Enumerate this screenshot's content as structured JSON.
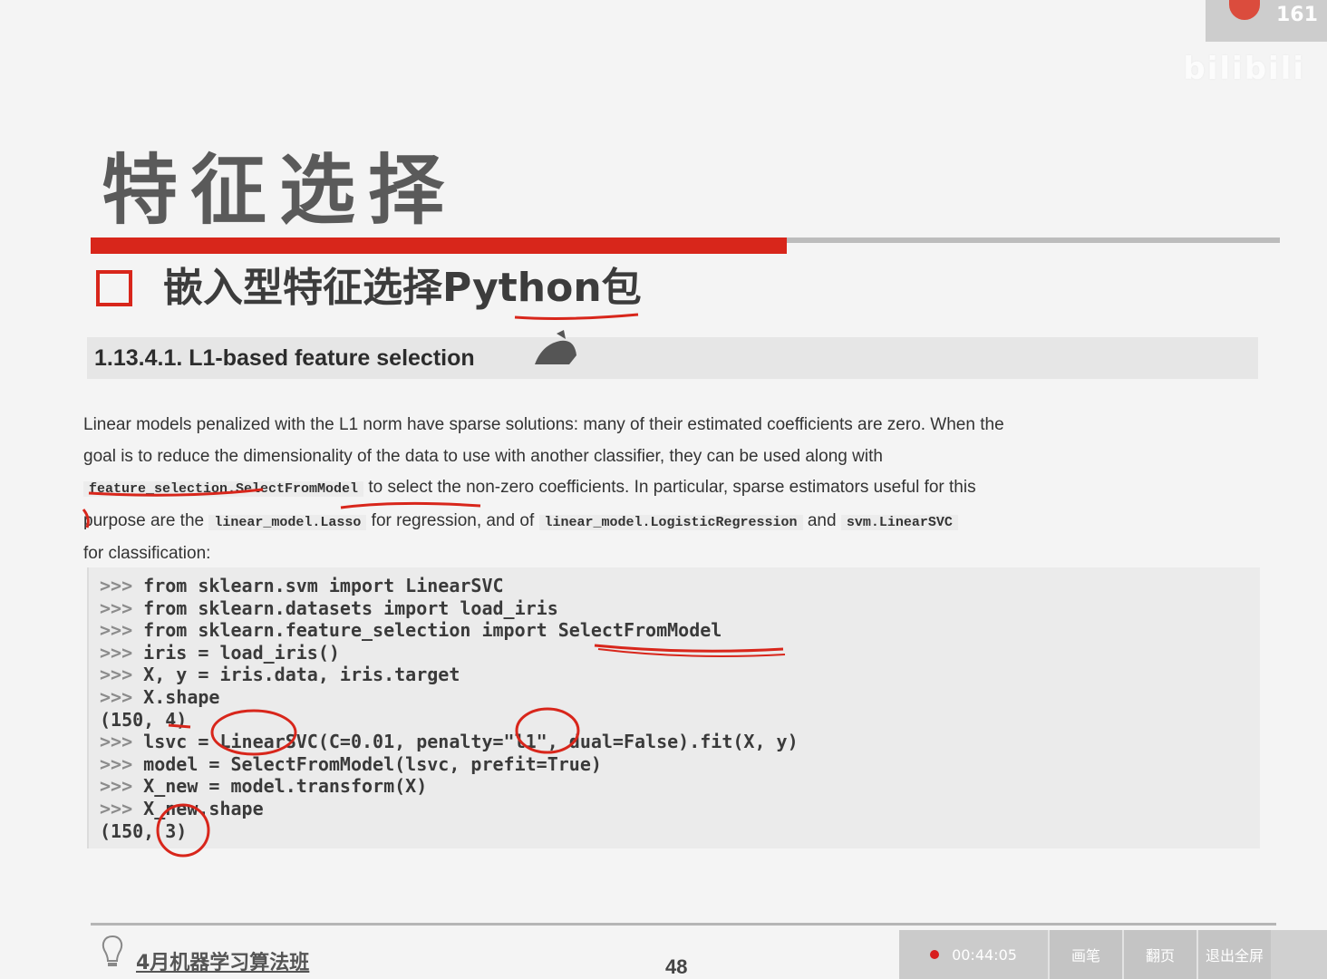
{
  "overlay": {
    "badge_number": "161",
    "watermark": "bilibili",
    "accent_color": "#d8261b"
  },
  "slide": {
    "title": "特征选择",
    "subtitle": "嵌入型特征选择Python包",
    "section_heading": "1.13.4.1. L1-based feature selection",
    "paragraph": {
      "line1": "Linear models penalized with the L1 norm have sparse solutions: many of their estimated coefficients are zero. When the",
      "line2": "goal is to reduce the dimensionality of the data to use with another classifier, they can be used along with",
      "line3_code": "feature_selection.SelectFromModel",
      "line3_text": " to select the non-zero coefficients. In particular, sparse estimators useful for this",
      "line4_text1": "purpose are the ",
      "line4_code1": "linear_model.Lasso",
      "line4_text2": " for regression, and of ",
      "line4_code2": "linear_model.LogisticRegression",
      "line4_text3": " and ",
      "line4_code3": "svm.LinearSVC",
      "line5": "for classification:"
    },
    "code_lines": [
      {
        "prompt": ">>> ",
        "text": "from sklearn.svm import LinearSVC"
      },
      {
        "prompt": ">>> ",
        "text": "from sklearn.datasets import load_iris"
      },
      {
        "prompt": ">>> ",
        "text": "from sklearn.feature_selection import SelectFromModel"
      },
      {
        "prompt": ">>> ",
        "text": "iris = load_iris()"
      },
      {
        "prompt": ">>> ",
        "text": "X, y = iris.data, iris.target"
      },
      {
        "prompt": ">>> ",
        "text": "X.shape"
      },
      {
        "prompt": "",
        "text": "(150, 4)"
      },
      {
        "prompt": ">>> ",
        "text": "lsvc = LinearSVC(C=0.01, penalty=\"l1\", dual=False).fit(X, y)"
      },
      {
        "prompt": ">>> ",
        "text": "model = SelectFromModel(lsvc, prefit=True)"
      },
      {
        "prompt": ">>> ",
        "text": "X_new = model.transform(X)"
      },
      {
        "prompt": ">>> ",
        "text": "X_new.shape"
      },
      {
        "prompt": "",
        "text": "(150, 3)"
      }
    ],
    "footer_course": "4月机器学习算法班",
    "page_number": "48"
  },
  "player_controls": {
    "record_time": "00:44:05",
    "btn1": "画笔",
    "btn2": "翻页",
    "btn3": "退出全屏"
  }
}
